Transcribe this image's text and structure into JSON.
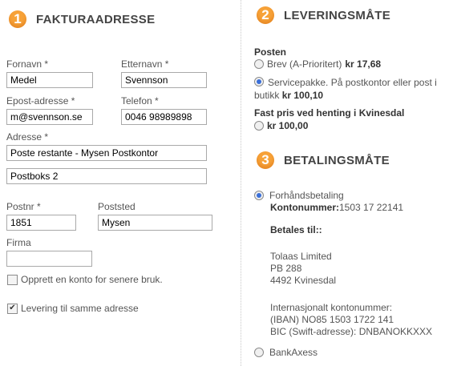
{
  "billing": {
    "step_number": "1",
    "title": "FAKTURAADRESSE",
    "first_name": {
      "label": "Fornavn *",
      "value": "Medel"
    },
    "last_name": {
      "label": "Etternavn *",
      "value": "Svennson"
    },
    "email": {
      "label": "Epost-adresse *",
      "value": "m@svennson.se"
    },
    "phone": {
      "label": "Telefon *",
      "value": "0046 98989898"
    },
    "address": {
      "label": "Adresse *",
      "line1": "Poste restante - Mysen Postkontor",
      "line2": "Postboks 2"
    },
    "postcode": {
      "label": "Postnr *",
      "value": "1851"
    },
    "city": {
      "label": "Poststed",
      "value": "Mysen"
    },
    "company": {
      "label": "Firma",
      "value": ""
    },
    "create_account": {
      "label": "Opprett en konto for senere bruk.",
      "checked": false
    },
    "same_delivery": {
      "label": "Levering til samme adresse",
      "checked": true
    }
  },
  "delivery": {
    "step_number": "2",
    "title": "LEVERINGSMÅTE",
    "group1_title": "Posten",
    "option_brev": {
      "text": "Brev (A-Prioritert)",
      "price": "kr 17,68",
      "selected": false
    },
    "option_service": {
      "text_line1": "Servicepakke. På postkontor eller post i",
      "text_line2": "butikk",
      "price": "kr 100,10",
      "selected": true
    },
    "group2_title": "Fast pris ved henting i Kvinesdal",
    "option_pickup": {
      "price": "kr 100,00",
      "selected": false
    }
  },
  "payment": {
    "step_number": "3",
    "title": "BETALINGSMÅTE",
    "option_prepay": {
      "label": "Forhåndsbetaling",
      "selected": true
    },
    "account_label": "Kontonummer:",
    "account_value": "1503 17 22141",
    "pay_to_label": "Betales til::",
    "payee_name": "Tolaas Limited",
    "payee_box": "PB 288",
    "payee_city": "4492 Kvinesdal",
    "intl_label": "Internasjonalt kontonummer:",
    "iban": "(IBAN) NO85 1503 1722 141",
    "bic": "BIC (Swift-adresse): DNBANOKKXXX",
    "option_bankaxess": {
      "label": "BankAxess",
      "selected": false
    }
  },
  "colors": {
    "accent": "#f7a238",
    "radio_selected": "#3a6fd8"
  }
}
